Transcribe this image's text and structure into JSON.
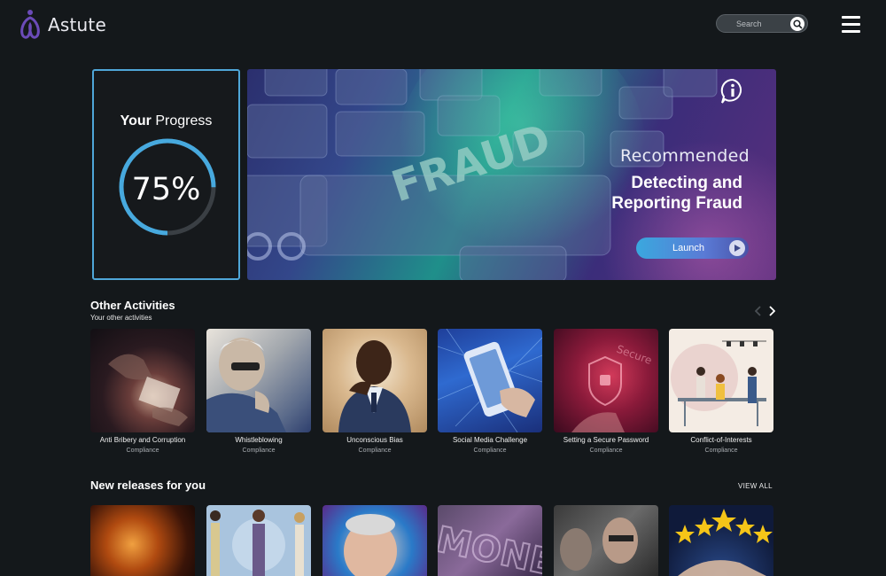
{
  "app": {
    "name": "Astute"
  },
  "search": {
    "placeholder": "Search"
  },
  "progress": {
    "title_bold": "Your",
    "title_rest": " Progress",
    "value_text": "75%",
    "value": 0.75
  },
  "banner": {
    "label": "Recommended",
    "title_line1": "Detecting and",
    "title_line2": "Reporting Fraud",
    "launch_label": "Launch",
    "image_text": "FRAUD"
  },
  "other_activities": {
    "title": "Other Activities",
    "subtitle": "Your other activities",
    "items": [
      {
        "name": "Anti Bribery and Corruption",
        "category": "Compliance"
      },
      {
        "name": "Whistleblowing",
        "category": "Compliance"
      },
      {
        "name": "Unconscious Bias",
        "category": "Compliance"
      },
      {
        "name": "Social Media Challenge",
        "category": "Compliance"
      },
      {
        "name": "Setting a Secure Password",
        "category": "Compliance"
      },
      {
        "name": "Conflict-of-Interests",
        "category": "Compliance"
      }
    ]
  },
  "new_releases": {
    "title": "New releases for you",
    "view_all": "VIEW ALL"
  },
  "icons": [
    "logo-icon",
    "search-icon",
    "menu-icon",
    "info-icon",
    "play-icon",
    "chevron-left-icon",
    "chevron-right-icon"
  ],
  "colors": {
    "accent": "#4fa6d8",
    "background": "#14181b",
    "brand": "#6b4bb8"
  }
}
